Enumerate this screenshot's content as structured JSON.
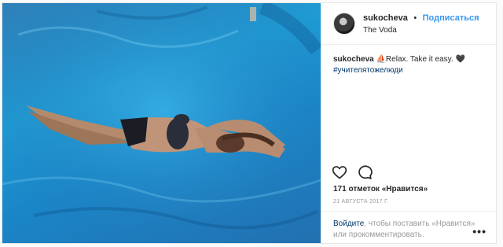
{
  "post": {
    "username": "sukocheva",
    "separator": "•",
    "follow_label": "Подписаться",
    "location": "The Voda",
    "caption_user": "sukocheva",
    "caption_text": "⛵Relax. Take it easy. 🖤",
    "hashtag": "#учителятожелюди",
    "likes": "171 отметок «Нравится»",
    "date": "21 августа 2017 г.",
    "login_link": "Войдите",
    "login_text_1": ", чтобы поставить «Нравится»",
    "login_text_2": "или прокомментировать.",
    "more_label": "•••"
  },
  "icons": {
    "like": "heart-outline-icon",
    "comment": "comment-bubble-icon",
    "more": "more-options-icon"
  },
  "colors": {
    "link_blue": "#3897f0",
    "water": "#1f9ad3",
    "border": "#e6e6e6"
  }
}
